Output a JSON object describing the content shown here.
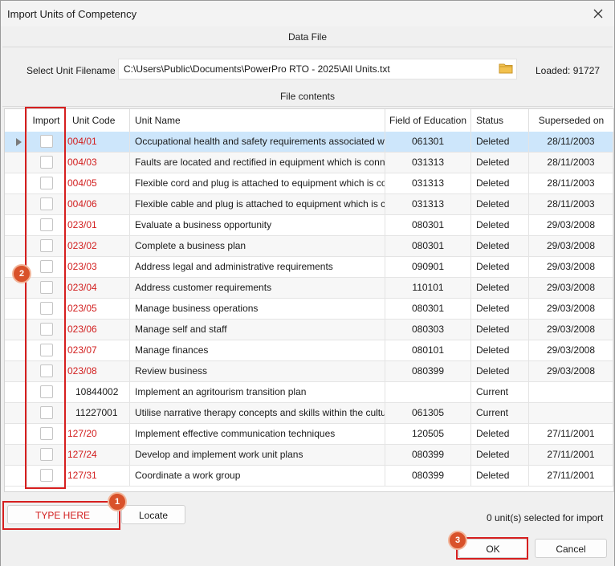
{
  "window": {
    "title": "Import Units of Competency"
  },
  "data_file": {
    "header": "Data File",
    "filename_label": "Select Unit Filename",
    "filename_value": "C:\\Users\\Public\\Documents\\PowerPro RTO - 2025\\All Units.txt",
    "loaded_text": "Loaded: 91727"
  },
  "file_contents": {
    "header": "File contents",
    "columns": [
      "Import",
      "Unit Code",
      "Unit Name",
      "Field of Education",
      "Status",
      "Superseded on"
    ],
    "rows": [
      {
        "code": "004/01",
        "name": "Occupational health and safety requirements associated with el",
        "field": "061301",
        "status": "Deleted",
        "superseded": "28/11/2003",
        "red": true
      },
      {
        "code": "004/03",
        "name": "Faults are located and rectified in equipment which is connected",
        "field": "031313",
        "status": "Deleted",
        "superseded": "28/11/2003",
        "red": true
      },
      {
        "code": "004/05",
        "name": "Flexible cord and plug is attached to equipment which is connect",
        "field": "031313",
        "status": "Deleted",
        "superseded": "28/11/2003",
        "red": true
      },
      {
        "code": "004/06",
        "name": "Flexible cable and plug is attached to equipment which is connec",
        "field": "031313",
        "status": "Deleted",
        "superseded": "28/11/2003",
        "red": true
      },
      {
        "code": "023/01",
        "name": "Evaluate a business opportunity",
        "field": "080301",
        "status": "Deleted",
        "superseded": "29/03/2008",
        "red": true
      },
      {
        "code": "023/02",
        "name": "Complete a business plan",
        "field": "080301",
        "status": "Deleted",
        "superseded": "29/03/2008",
        "red": true
      },
      {
        "code": "023/03",
        "name": "Address legal and administrative requirements",
        "field": "090901",
        "status": "Deleted",
        "superseded": "29/03/2008",
        "red": true
      },
      {
        "code": "023/04",
        "name": "Address customer requirements",
        "field": "110101",
        "status": "Deleted",
        "superseded": "29/03/2008",
        "red": true
      },
      {
        "code": "023/05",
        "name": "Manage business operations",
        "field": "080301",
        "status": "Deleted",
        "superseded": "29/03/2008",
        "red": true
      },
      {
        "code": "023/06",
        "name": "Manage self and staff",
        "field": "080303",
        "status": "Deleted",
        "superseded": "29/03/2008",
        "red": true
      },
      {
        "code": "023/07",
        "name": "Manage finances",
        "field": "080101",
        "status": "Deleted",
        "superseded": "29/03/2008",
        "red": true
      },
      {
        "code": "023/08",
        "name": "Review business",
        "field": "080399",
        "status": "Deleted",
        "superseded": "29/03/2008",
        "red": true
      },
      {
        "code": "10844002",
        "name": "Implement an agritourism transition plan",
        "field": "",
        "status": "Current",
        "superseded": "",
        "red": false
      },
      {
        "code": "11227001",
        "name": "Utilise narrative therapy concepts and skills within the cultural co",
        "field": "061305",
        "status": "Current",
        "superseded": "",
        "red": false
      },
      {
        "code": "127/20",
        "name": "Implement effective communication techniques",
        "field": "120505",
        "status": "Deleted",
        "superseded": "27/11/2001",
        "red": true
      },
      {
        "code": "127/24",
        "name": "Develop and implement work unit plans",
        "field": "080399",
        "status": "Deleted",
        "superseded": "27/11/2001",
        "red": true
      },
      {
        "code": "127/31",
        "name": "Coordinate a work group",
        "field": "080399",
        "status": "Deleted",
        "superseded": "27/11/2001",
        "red": true
      }
    ]
  },
  "footer": {
    "search_placeholder": "TYPE HERE",
    "locate_label": "Locate",
    "selected_text": "0 unit(s) selected for import",
    "ok_label": "OK",
    "cancel_label": "Cancel"
  },
  "annotations": {
    "marker1": "1",
    "marker2": "2",
    "marker3": "3"
  },
  "colors": {
    "selected_row": "#cde6fb",
    "red_code": "#d21f1f",
    "highlight_box": "#d61f1f",
    "marker": "#d9522b"
  }
}
